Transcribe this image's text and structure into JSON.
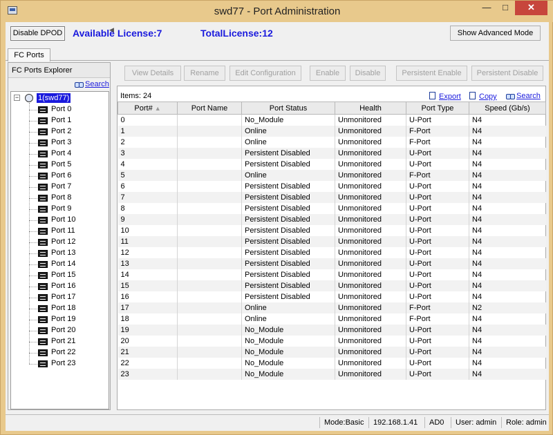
{
  "window": {
    "title": "swd77 - Port Administration",
    "min": "—",
    "max": "□",
    "close": "✕"
  },
  "topbar": {
    "disable_dpod": "Disable DPOD",
    "available_license": "Available License:7",
    "total_license": "TotalLicense:12",
    "advanced_mode": "Show Advanced Mode"
  },
  "tabs": [
    {
      "label": "FC Ports"
    }
  ],
  "explorer": {
    "header": "FC Ports Explorer",
    "search": "Search",
    "root": "1(swd77)",
    "toggle": "−",
    "ports": [
      "Port 0",
      "Port 1",
      "Port 2",
      "Port 3",
      "Port 4",
      "Port 5",
      "Port 6",
      "Port 7",
      "Port 8",
      "Port 9",
      "Port 10",
      "Port 11",
      "Port 12",
      "Port 13",
      "Port 14",
      "Port 15",
      "Port 16",
      "Port 17",
      "Port 18",
      "Port 19",
      "Port 20",
      "Port 21",
      "Port 22",
      "Port 23"
    ]
  },
  "toolbar": {
    "view_details": "View Details",
    "rename": "Rename",
    "edit_configuration": "Edit Configuration",
    "enable": "Enable",
    "disable": "Disable",
    "persistent_enable": "Persistent Enable",
    "persistent_disable": "Persistent Disable"
  },
  "grid": {
    "items": "Items: 24",
    "export": "Export",
    "copy": "Copy",
    "search": "Search",
    "columns": [
      "Port#",
      "Port Name",
      "Port Status",
      "Health",
      "Port Type",
      "Speed (Gb/s)"
    ],
    "sort_indicator": "▲",
    "rows": [
      [
        "0",
        "",
        "No_Module",
        "Unmonitored",
        "U-Port",
        "N4"
      ],
      [
        "1",
        "",
        "Online",
        "Unmonitored",
        "F-Port",
        "N4"
      ],
      [
        "2",
        "",
        "Online",
        "Unmonitored",
        "F-Port",
        "N4"
      ],
      [
        "3",
        "",
        "Persistent Disabled",
        "Unmonitored",
        "U-Port",
        "N4"
      ],
      [
        "4",
        "",
        "Persistent Disabled",
        "Unmonitored",
        "U-Port",
        "N4"
      ],
      [
        "5",
        "",
        "Online",
        "Unmonitored",
        "F-Port",
        "N4"
      ],
      [
        "6",
        "",
        "Persistent Disabled",
        "Unmonitored",
        "U-Port",
        "N4"
      ],
      [
        "7",
        "",
        "Persistent Disabled",
        "Unmonitored",
        "U-Port",
        "N4"
      ],
      [
        "8",
        "",
        "Persistent Disabled",
        "Unmonitored",
        "U-Port",
        "N4"
      ],
      [
        "9",
        "",
        "Persistent Disabled",
        "Unmonitored",
        "U-Port",
        "N4"
      ],
      [
        "10",
        "",
        "Persistent Disabled",
        "Unmonitored",
        "U-Port",
        "N4"
      ],
      [
        "11",
        "",
        "Persistent Disabled",
        "Unmonitored",
        "U-Port",
        "N4"
      ],
      [
        "12",
        "",
        "Persistent Disabled",
        "Unmonitored",
        "U-Port",
        "N4"
      ],
      [
        "13",
        "",
        "Persistent Disabled",
        "Unmonitored",
        "U-Port",
        "N4"
      ],
      [
        "14",
        "",
        "Persistent Disabled",
        "Unmonitored",
        "U-Port",
        "N4"
      ],
      [
        "15",
        "",
        "Persistent Disabled",
        "Unmonitored",
        "U-Port",
        "N4"
      ],
      [
        "16",
        "",
        "Persistent Disabled",
        "Unmonitored",
        "U-Port",
        "N4"
      ],
      [
        "17",
        "",
        "Online",
        "Unmonitored",
        "F-Port",
        "N2"
      ],
      [
        "18",
        "",
        "Online",
        "Unmonitored",
        "F-Port",
        "N4"
      ],
      [
        "19",
        "",
        "No_Module",
        "Unmonitored",
        "U-Port",
        "N4"
      ],
      [
        "20",
        "",
        "No_Module",
        "Unmonitored",
        "U-Port",
        "N4"
      ],
      [
        "21",
        "",
        "No_Module",
        "Unmonitored",
        "U-Port",
        "N4"
      ],
      [
        "22",
        "",
        "No_Module",
        "Unmonitored",
        "U-Port",
        "N4"
      ],
      [
        "23",
        "",
        "No_Module",
        "Unmonitored",
        "U-Port",
        "N4"
      ]
    ]
  },
  "status": {
    "mode": "Mode:Basic",
    "ip": "192.168.1.41",
    "ad": "AD0",
    "user": "User: admin",
    "role": "Role: admin"
  },
  "colors": {
    "accent": "#1a1add",
    "frame": "#e8c98c",
    "close": "#c7463c"
  }
}
